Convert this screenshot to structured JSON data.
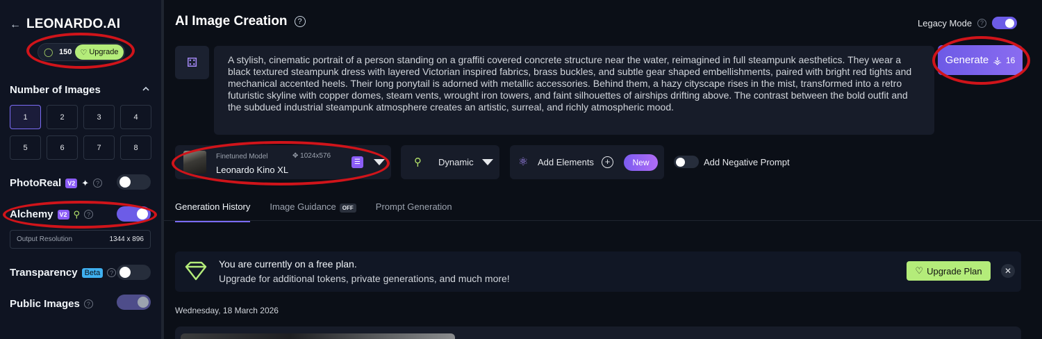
{
  "sidebar": {
    "back_icon": "arrow-left-icon",
    "logo": "LEONARDO.AI",
    "tokens": "150",
    "upgrade_label": "Upgrade",
    "num_images_title": "Number of Images",
    "num_options": [
      "1",
      "2",
      "3",
      "4",
      "5",
      "6",
      "7",
      "8"
    ],
    "num_selected": "1",
    "photoreal_label": "PhotoReal",
    "photoreal_badge": "V2",
    "photoreal_on": false,
    "alchemy_label": "Alchemy",
    "alchemy_badge": "V2",
    "alchemy_on": true,
    "output_res_label": "Output Resolution",
    "output_res_value": "1344 x 896",
    "transparency_label": "Transparency",
    "transparency_badge": "Beta",
    "transparency_on": false,
    "public_images_label": "Public Images",
    "public_images_on": true
  },
  "main": {
    "title": "AI Image Creation",
    "legacy_mode_label": "Legacy Mode",
    "legacy_mode_on": true,
    "prompt_text": "A stylish, cinematic portrait of a person standing on a graffiti covered concrete structure near the water, reimagined in full steampunk aesthetics. They wear a black textured steampunk dress with layered Victorian inspired fabrics, brass buckles, and subtle gear shaped embellishments, paired with bright red tights and mechanical accented heels. Their long ponytail is adorned with metallic accessories. Behind them, a hazy cityscape rises in the mist, transformed into a retro futuristic skyline with copper domes, steam vents, wrought iron towers, and faint silhouettes of airships drifting above. The contrast between the bold outfit and the subdued industrial steampunk atmosphere creates an artistic, surreal, and richly atmospheric mood.",
    "generate_label": "Generate",
    "generate_cost": "16",
    "model_sub": "Finetuned Model",
    "model_dims": "1024x576",
    "model_name": "Leonardo Kino XL",
    "style_label": "Dynamic",
    "elements_label": "Add Elements",
    "new_badge": "New",
    "negative_prompt_label": "Add Negative Prompt",
    "tabs": [
      {
        "label": "Generation History",
        "active": true
      },
      {
        "label": "Image Guidance",
        "badge": "OFF"
      },
      {
        "label": "Prompt Generation"
      }
    ],
    "plan_line1": "You are currently on a free plan.",
    "plan_line2": "Upgrade for additional tokens, private generations, and much more!",
    "upgrade_plan_label": "Upgrade Plan",
    "date_label": "Wednesday, 18 March 2026"
  },
  "colors": {
    "accent": "#7b6cf5",
    "upgrade_green": "#b4ec7a",
    "annotation_red": "#d0141a"
  }
}
